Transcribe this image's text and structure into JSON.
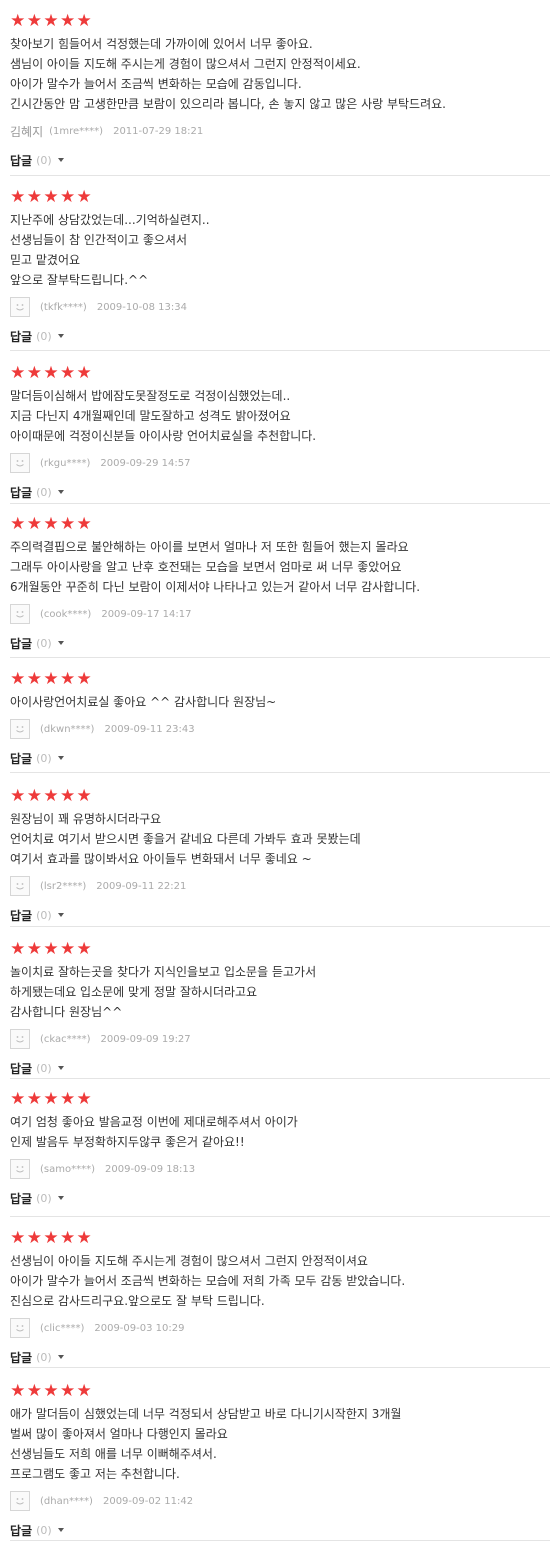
{
  "star_glyph": "★",
  "star_color": "#ee3a3a",
  "reply_label": "답글",
  "reviews": [
    {
      "rating": 5,
      "lines": [
        "찾아보기 힘들어서 걱정했는데 가까이에 있어서 너무 좋아요.",
        "샘님이 아이들 지도해 주시는게 경험이 많으셔서 그런지 안정적이세요.",
        "아이가 말수가 늘어서 조금씩 변화하는 모습에 감동입니다.",
        "긴시간동안 맘 고생한만큼 보람이 있으리라 봅니다, 손 놓지 않고 많은 사랑 부탁드려요."
      ],
      "author_name": "김혜지",
      "user_id": "(1mre****)",
      "timestamp": "2011-07-29 18:21",
      "reply_count": "(0)"
    },
    {
      "rating": 5,
      "lines": [
        "지난주에 상담갔었는데...기억하실련지..",
        "선생님들이 참 인간적이고 좋으셔서",
        "믿고 맡겼어요",
        "앞으로 잘부탁드립니다.^^"
      ],
      "user_id": "(tkfk****)",
      "timestamp": "2009-10-08 13:34",
      "reply_count": "(0)"
    },
    {
      "rating": 5,
      "lines": [
        "말더듬이심해서 밥에잠도못잘정도로 걱정이심했었는데..",
        "지금 다닌지 4개월째인데 말도잘하고 성격도 밝아졌어요",
        "아이때문에 걱정이신분들 아이사랑 언어치료실을 추천합니다."
      ],
      "user_id": "(rkgu****)",
      "timestamp": "2009-09-29 14:57",
      "reply_count": "(0)"
    },
    {
      "rating": 5,
      "lines": [
        "주의력결핍으로 불안해하는 아이를 보면서 얼마나 저 또한 힘들어 했는지 몰라요",
        "그래두 아이사랑을 알고 난후 호전돼는 모습을 보면서 엄마로 써 너무 좋았어요",
        "6개월동안 꾸준히 다닌 보람이 이제서야 나타나고 있는거 같아서 너무 감사합니다."
      ],
      "user_id": "(cook****)",
      "timestamp": "2009-09-17 14:17",
      "reply_count": "(0)"
    },
    {
      "rating": 5,
      "lines": [
        "아이사랑언어치료실 좋아요 ^^ 감사합니다 원장님~"
      ],
      "user_id": "(dkwn****)",
      "timestamp": "2009-09-11 23:43",
      "reply_count": "(0)"
    },
    {
      "rating": 5,
      "lines": [
        "원장님이 꽤 유명하시더라구요",
        "언어치료 여기서 받으시면 좋을거 같네요 다른데 가봐두 효과 못봤는데",
        "여기서 효과를 많이봐서요 아이들두 변화돼서 너무 좋네요 ~"
      ],
      "user_id": "(lsr2****)",
      "timestamp": "2009-09-11 22:21",
      "reply_count": "(0)"
    },
    {
      "rating": 5,
      "lines": [
        "놀이치료 잘하는곳을 찾다가 지식인을보고 입소문을 듣고가서",
        "하게됐는데요 입소문에 맞게 정말 잘하시더라고요",
        "감사합니다 원장님^^"
      ],
      "user_id": "(ckac****)",
      "timestamp": "2009-09-09 19:27",
      "reply_count": "(0)"
    },
    {
      "rating": 5,
      "lines": [
        "여기 엄청 좋아요 발음교정 이번에 제대로해주셔서 아이가",
        "인제 발음두 부정확하지두않쿠 좋은거 같아요!!"
      ],
      "user_id": "(samo****)",
      "timestamp": "2009-09-09 18:13",
      "reply_count": "(0)"
    },
    {
      "rating": 5,
      "lines": [
        "선생님이 아이들 지도해 주시는게 경험이 많으셔서 그런지 안정적이셔요",
        "아이가 말수가 늘어서 조금씩 변화하는 모습에 저희 가족 모두 감동 받았습니다.",
        "진심으로 감사드리구요.앞으로도 잘 부탁 드립니다."
      ],
      "user_id": "(clic****)",
      "timestamp": "2009-09-03 10:29",
      "reply_count": "(0)"
    },
    {
      "rating": 5,
      "lines": [
        "애가 말더듬이 심했었는데 너무 걱정되서 상담받고 바로 다니기시작한지 3개월",
        "벌써 많이 좋아져서 얼마나 다행인지 몰라요",
        "선생님들도 저희 애를 너무 이뻐해주셔서.",
        "프로그램도 좋고 저는 추천합니다."
      ],
      "user_id": "(dhan****)",
      "timestamp": "2009-09-02 11:42",
      "reply_count": "(0)"
    }
  ]
}
